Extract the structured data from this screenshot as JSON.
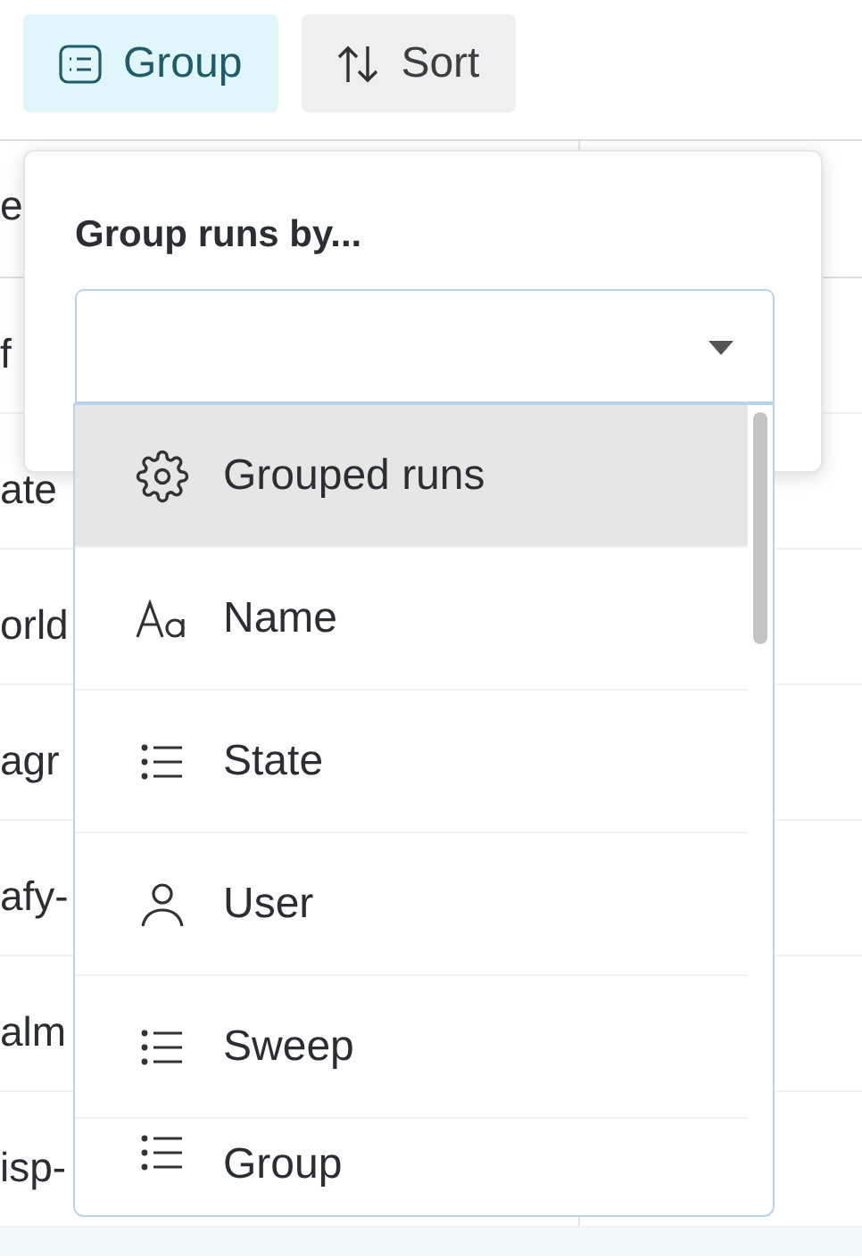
{
  "toolbar": {
    "buttons": [
      {
        "label": "Group",
        "selected": true
      },
      {
        "label": "Sort",
        "selected": false
      }
    ]
  },
  "table": {
    "header": "e",
    "rows": [
      "f",
      "ate",
      "orld",
      "agr",
      "afy-",
      "alm",
      "isp-"
    ]
  },
  "popover": {
    "title": "Group runs by...",
    "options": [
      {
        "label": "Grouped runs",
        "selected": true
      },
      {
        "label": "Name",
        "selected": false
      },
      {
        "label": "State",
        "selected": false
      },
      {
        "label": "User",
        "selected": false
      },
      {
        "label": "Sweep",
        "selected": false
      },
      {
        "label": "Group",
        "selected": false
      }
    ]
  }
}
